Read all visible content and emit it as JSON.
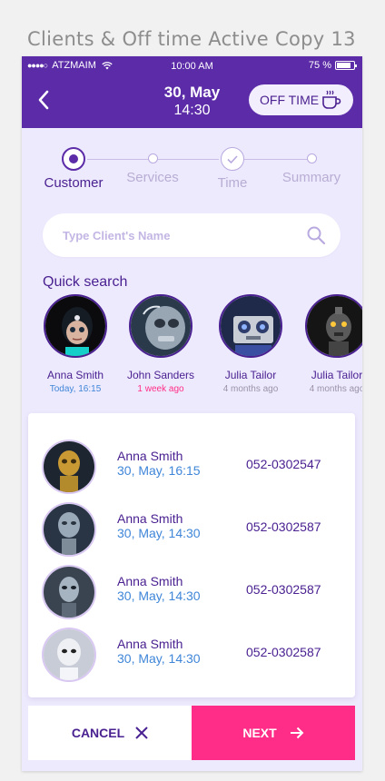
{
  "artboard_title": "Clients  & Off time Active Copy 13",
  "status_bar": {
    "signal": "●●●●○",
    "carrier": "ATZMAIM",
    "time": "10:00 AM",
    "battery": "75 %"
  },
  "header": {
    "date": "30, May",
    "time": "14:30",
    "off_time_label": "OFF TIME",
    "color": "#5b2ba8"
  },
  "steps": [
    {
      "label": "Customer",
      "state": "active"
    },
    {
      "label": "Services",
      "state": "pending"
    },
    {
      "label": "Time",
      "state": "done"
    },
    {
      "label": "Summary",
      "state": "pending"
    }
  ],
  "search": {
    "placeholder": "Type Client's Name",
    "value": ""
  },
  "quick_search": {
    "title": "Quick search",
    "clients": [
      {
        "name": "Anna Smith",
        "when": "Today, 16:15",
        "when_color": "#3f86d8"
      },
      {
        "name": "John Sanders",
        "when": "1 week ago",
        "when_color": "#ff2d87"
      },
      {
        "name": "Julia Tailor",
        "when": "4 months ago",
        "when_color": "#9a93a8"
      },
      {
        "name": "Julia Tailor",
        "when": "4 months ago",
        "when_color": "#9a93a8"
      }
    ]
  },
  "client_list": [
    {
      "name": "Anna Smith",
      "date": "30, May, 16:15",
      "phone": "052-0302547"
    },
    {
      "name": "Anna Smith",
      "date": "30, May, 14:30",
      "phone": "052-0302587"
    },
    {
      "name": "Anna Smith",
      "date": "30, May, 14:30",
      "phone": "052-0302587"
    },
    {
      "name": "Anna Smith",
      "date": "30, May, 14:30",
      "phone": "052-0302587"
    }
  ],
  "actions": {
    "cancel_label": "CANCEL",
    "next_label": "NEXT",
    "accent": "#ff2d87"
  }
}
